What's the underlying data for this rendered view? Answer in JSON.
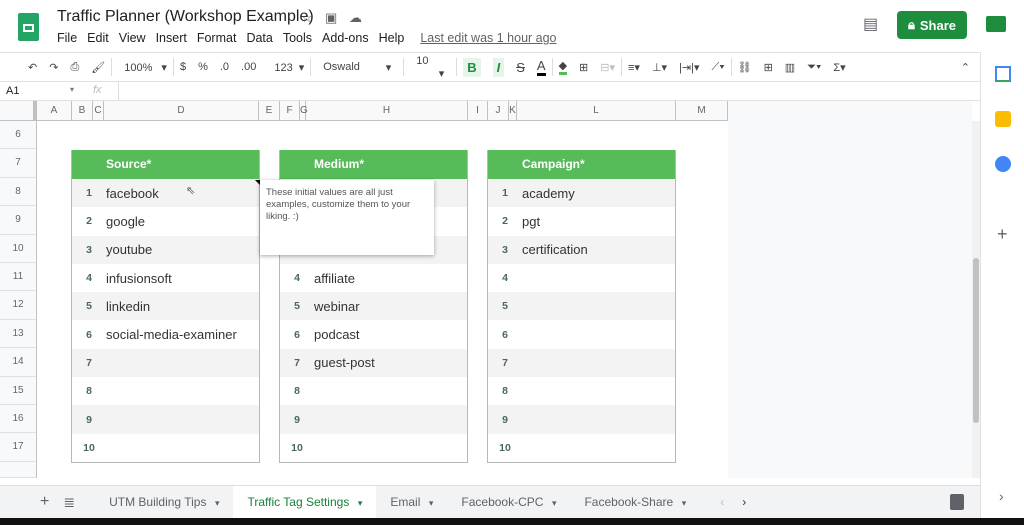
{
  "app": {
    "title": "Traffic Planner (Workshop Example)",
    "menu": [
      "File",
      "Edit",
      "View",
      "Insert",
      "Format",
      "Data",
      "Tools",
      "Add-ons",
      "Help"
    ],
    "last_edit": "Last edit was 1 hour ago",
    "share": "Share",
    "accent": "#1e8e3e"
  },
  "toolbar": {
    "zoom": "100%",
    "currency": "$",
    "percent": "%",
    "dec_less": ".0",
    "dec_more": ".00",
    "format": "123",
    "font": "Oswald",
    "size": "10",
    "bold": "B",
    "italic": "I",
    "strike": "S",
    "text_color": "A"
  },
  "formula": {
    "cell_ref": "A1",
    "fx": "fx"
  },
  "columns": [
    "A",
    "B",
    "C",
    "D",
    "E",
    "F",
    "G",
    "H",
    "I",
    "J",
    "K",
    "L",
    "M"
  ],
  "rows": [
    "6",
    "7",
    "8",
    "9",
    "10",
    "11",
    "12",
    "13",
    "14",
    "15",
    "16",
    "17"
  ],
  "tables": [
    {
      "header": "Source*",
      "items": [
        "facebook",
        "google",
        "youtube",
        "infusionsoft",
        "linkedin",
        "social-media-examiner",
        "",
        "",
        "",
        ""
      ]
    },
    {
      "header": "Medium*",
      "items": [
        "",
        "",
        "",
        "affiliate",
        "webinar",
        "podcast",
        "guest-post",
        "",
        "",
        ""
      ]
    },
    {
      "header": "Campaign*",
      "items": [
        "academy",
        "pgt",
        "certification",
        "",
        "",
        "",
        "",
        "",
        "",
        ""
      ]
    }
  ],
  "numbers": [
    "1",
    "2",
    "3",
    "4",
    "5",
    "6",
    "7",
    "8",
    "9",
    "10"
  ],
  "comment": "These initial values are all just examples, customize them to your liking. :)",
  "header_color": "#57bb5a",
  "sheets": [
    {
      "label": "UTM Building Tips",
      "active": false
    },
    {
      "label": "Traffic Tag Settings",
      "active": true
    },
    {
      "label": "Email",
      "active": false
    },
    {
      "label": "Facebook-CPC",
      "active": false
    },
    {
      "label": "Facebook-Share",
      "active": false
    }
  ]
}
